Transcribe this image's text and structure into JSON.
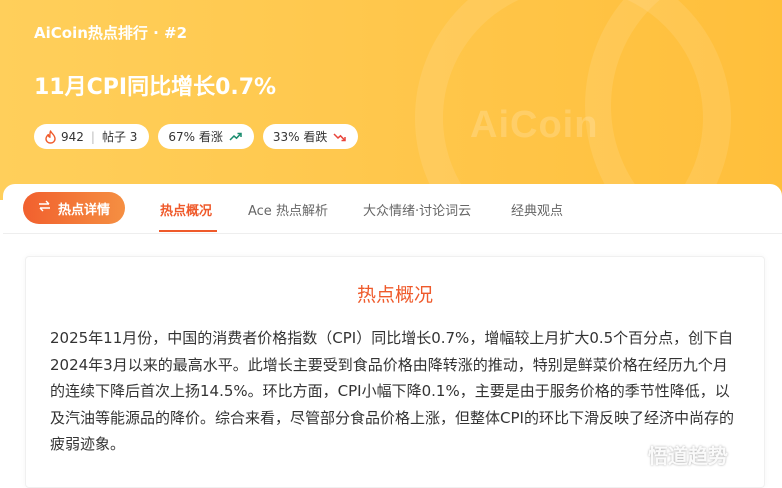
{
  "header": {
    "breadcrumb": "AiCoin热点排行 · #2",
    "title": "11月CPI同比增长0.7%",
    "watermark": "AiCoin"
  },
  "stats": {
    "heat": "942",
    "posts": "帖子 3",
    "bullish": "67% 看涨",
    "bearish": "33% 看跌"
  },
  "nav": {
    "hot_button": "热点详情",
    "tabs": [
      "热点概况",
      "Ace 热点解析",
      "大众情绪·讨论词云",
      "经典观点"
    ],
    "active_tab": "热点概况"
  },
  "overview": {
    "title": "热点概况",
    "text": "2025年11月份，中国的消费者价格指数（CPI）同比增长0.7%，增幅较上月扩大0.5个百分点，创下自2024年3月以来的最高水平。此增长主要受到食品价格由降转涨的推动，特别是鲜菜价格在经历九个月的连续下降后首次上扬14.5%。环比方面，CPI小幅下降0.1%，主要是由于服务价格的季节性降低，以及汽油等能源品的降价。综合来看，尽管部分食品价格上涨，但整体CPI的环比下滑反映了经济中尚存的疲弱迹象。"
  },
  "footer": {
    "watermark": "悟道趋势"
  },
  "colors": {
    "hero_bg": "#ffc64a",
    "accent": "#ef5a2b",
    "bullish": "#1a8c6f",
    "bearish": "#e8453c"
  },
  "icons": {
    "heat": "flame-icon",
    "bullish": "trend-up-icon",
    "bearish": "trend-down-icon",
    "hot_button": "swap-arrows-icon",
    "footer": "logo-icon"
  }
}
